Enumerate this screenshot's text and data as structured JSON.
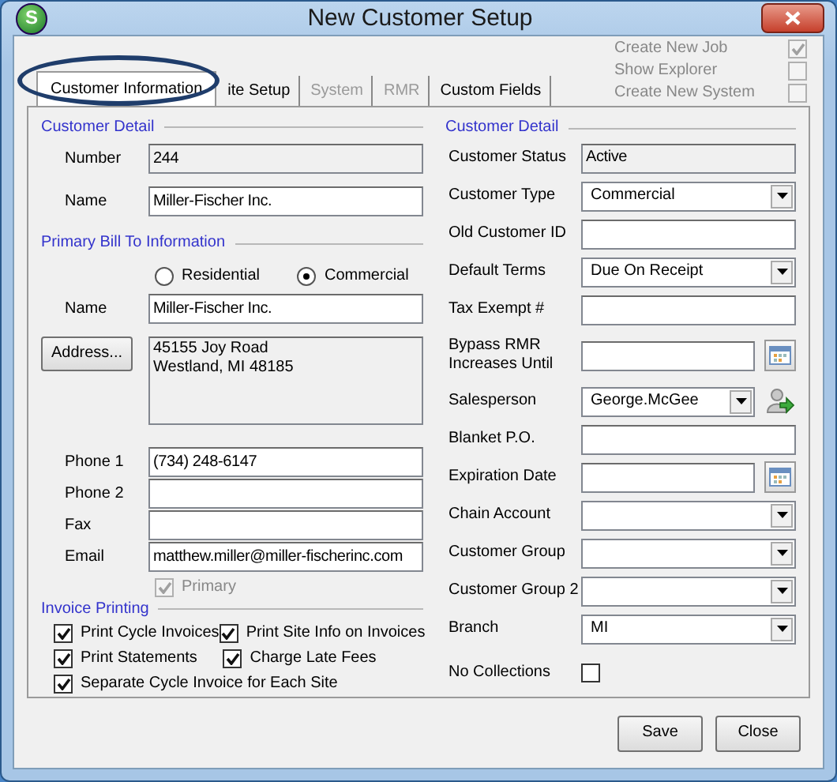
{
  "window": {
    "title": "New Customer Setup",
    "app_icon_letter": "S"
  },
  "options": [
    {
      "label": "Create New Job",
      "checked": true,
      "disabled": true
    },
    {
      "label": "Show Explorer",
      "checked": false,
      "disabled": true
    },
    {
      "label": "Create New System",
      "checked": false,
      "disabled": true
    }
  ],
  "tabs": [
    {
      "label": "Customer Information",
      "selected": true,
      "disabled": false
    },
    {
      "label": "ite Setup",
      "selected": false,
      "disabled": false
    },
    {
      "label": "System",
      "selected": false,
      "disabled": true
    },
    {
      "label": "RMR",
      "selected": false,
      "disabled": true
    },
    {
      "label": "Custom Fields",
      "selected": false,
      "disabled": false
    }
  ],
  "customer_detail_left": {
    "heading": "Customer Detail",
    "fields": [
      {
        "label": "Number",
        "value": "244",
        "readonly": true
      },
      {
        "label": "Name",
        "value": "Miller-Fischer Inc.",
        "readonly": false
      }
    ]
  },
  "bill_to": {
    "heading": "Primary Bill To Information",
    "radios": [
      {
        "label": "Residential",
        "selected": false
      },
      {
        "label": "Commercial",
        "selected": true
      }
    ],
    "name": {
      "label": "Name",
      "value": "Miller-Fischer Inc."
    },
    "address": {
      "button": "Address...",
      "lines": [
        "45155 Joy Road",
        "Westland, MI  48185"
      ]
    },
    "contacts": [
      {
        "label": "Phone 1",
        "value": "(734) 248-6147"
      },
      {
        "label": "Phone 2"
      },
      {
        "label": "Fax"
      },
      {
        "label": "Email",
        "value": "matthew.miller@miller-fischerinc.com"
      }
    ],
    "primary": {
      "label": "Primary",
      "checked": true,
      "disabled": true
    }
  },
  "invoice_printing": {
    "heading": "Invoice Printing",
    "rows": [
      [
        {
          "label": "Print Cycle Invoices",
          "checked": true
        },
        {
          "label": "Print Site Info on Invoices",
          "checked": true
        }
      ],
      [
        {
          "label": "Print Statements",
          "checked": true
        },
        {
          "label": "Charge Late Fees",
          "checked": true
        }
      ],
      [
        {
          "label": "Separate Cycle Invoice for Each Site",
          "checked": true
        }
      ]
    ]
  },
  "customer_detail_right": {
    "heading": "Customer Detail",
    "fields": [
      {
        "kind": "readonly",
        "label": "Customer Status",
        "value": "Active"
      },
      {
        "kind": "select",
        "label": "Customer Type",
        "value": "Commercial"
      },
      {
        "kind": "text",
        "label": "Old Customer ID"
      },
      {
        "kind": "select",
        "label": "Default Terms",
        "value": "Due On Receipt"
      },
      {
        "kind": "text",
        "label": "Tax Exempt #"
      },
      {
        "kind": "date",
        "label": "Bypass RMR Increases Until"
      },
      {
        "kind": "lookup",
        "label": "Salesperson",
        "value": "George.McGee"
      },
      {
        "kind": "text",
        "label": "Blanket P.O."
      },
      {
        "kind": "date",
        "label": "Expiration Date"
      },
      {
        "kind": "select",
        "label": "Chain Account"
      },
      {
        "kind": "select",
        "label": "Customer Group"
      },
      {
        "kind": "select",
        "label": "Customer Group 2"
      },
      {
        "kind": "select",
        "label": "Branch",
        "value": "MI"
      },
      {
        "kind": "checkbox",
        "label": "No Collections",
        "checked": false
      }
    ]
  },
  "buttons": [
    "Save",
    "Close"
  ]
}
